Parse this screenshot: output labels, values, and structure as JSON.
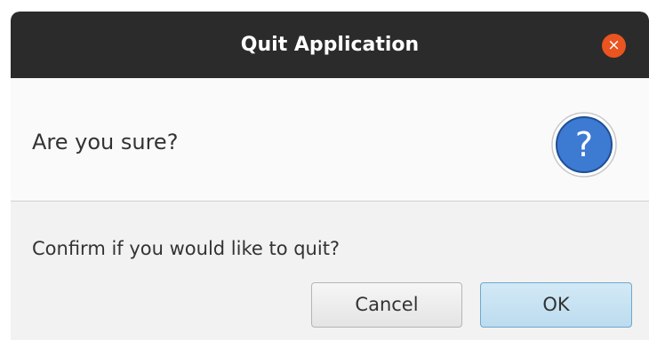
{
  "dialog": {
    "title": "Quit Application",
    "close_label": "×",
    "header_text": "Are you sure?",
    "icon": "question-icon",
    "content_text": "Confirm if you would like to quit?",
    "buttons": {
      "cancel_label": "Cancel",
      "ok_label": "OK"
    }
  },
  "colors": {
    "titlebar": "#2b2b2b",
    "close_button": "#e95420",
    "icon_blue": "#3d7ad1",
    "ok_button": "#bcdcef"
  }
}
